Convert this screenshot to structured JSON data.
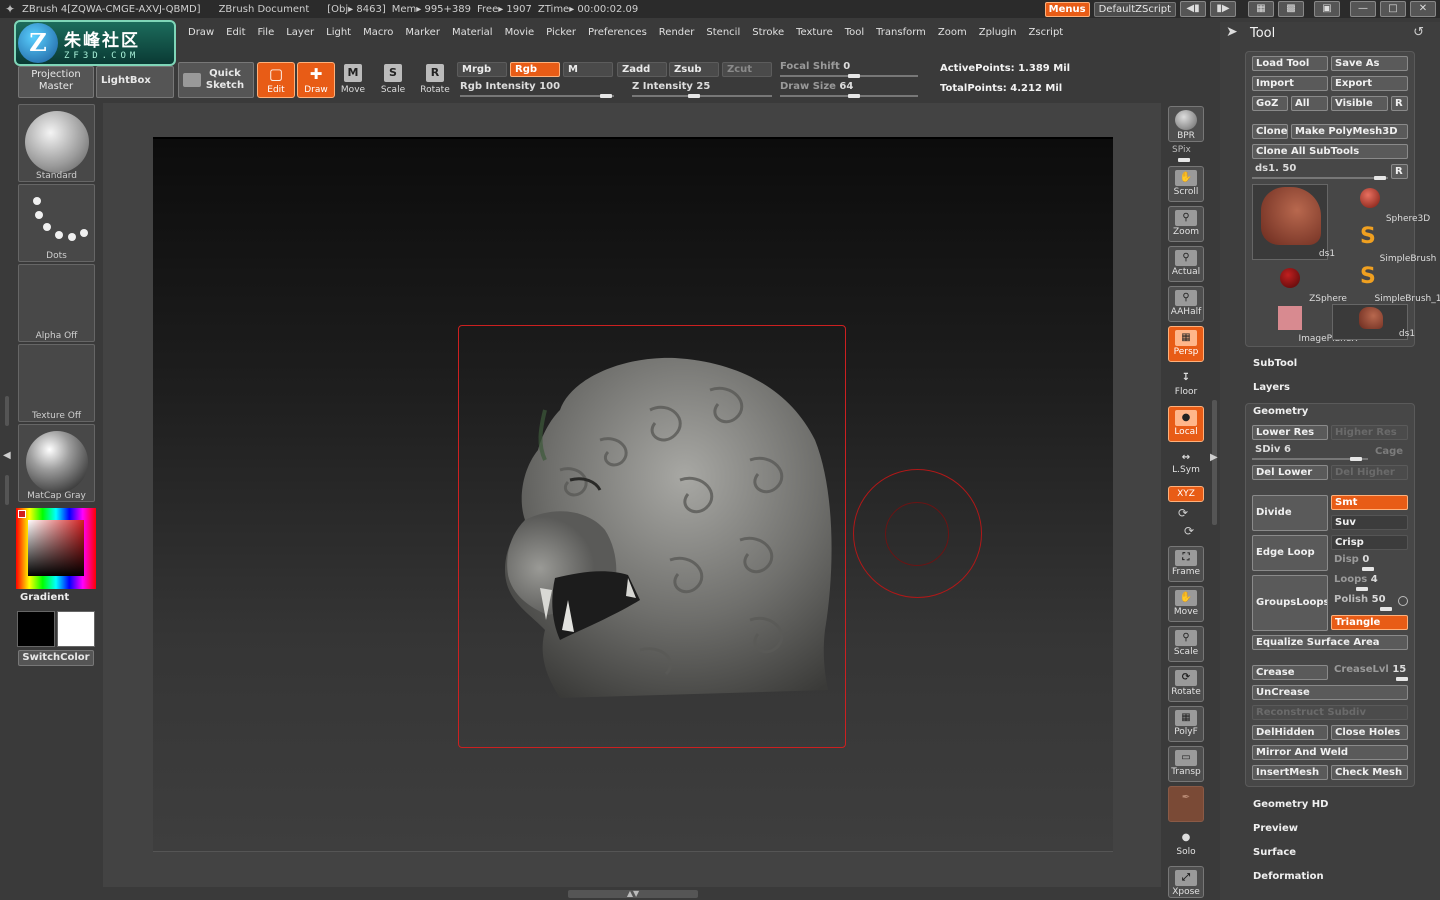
{
  "titlebar": {
    "app_title": "ZBrush 4[ZQWA-CMGE-AXVJ-QBMD]",
    "document": "ZBrush Document",
    "obj": "[Obj▸ 8463]",
    "mem": "Mem▸ 995+389",
    "free": "Free▸ 1907",
    "ztime": "ZTime▸ 00:00:02.09",
    "menus_label": "Menus",
    "script_label": "DefaultZScript"
  },
  "logo": {
    "mark": "Z",
    "cn": "朱峰社区",
    "en": "ZF3D.COM"
  },
  "menubar": [
    "Draw",
    "Edit",
    "File",
    "Layer",
    "Light",
    "Macro",
    "Marker",
    "Material",
    "Movie",
    "Picker",
    "Preferences",
    "Render",
    "Stencil",
    "Stroke",
    "Texture",
    "Tool",
    "Transform",
    "Zoom",
    "Zplugin",
    "Zscript"
  ],
  "shelf": {
    "projection_master": "Projection Master",
    "lightbox": "LightBox",
    "quick_sketch": "Quick Sketch",
    "edit": "Edit",
    "draw": "Draw",
    "move": "Move",
    "scale": "Scale",
    "rotate": "Rotate",
    "move_ico": "M",
    "scale_ico": "S",
    "rotate_ico": "R"
  },
  "params": {
    "mrgb": "Mrgb",
    "rgb": "Rgb",
    "m": "M",
    "zadd": "Zadd",
    "zsub": "Zsub",
    "zcut": "Zcut",
    "rgb_intensity_label": "Rgb Intensity",
    "rgb_intensity": "100",
    "z_intensity_label": "Z Intensity",
    "z_intensity": "25",
    "focal_shift_label": "Focal Shift",
    "focal_shift": "0",
    "draw_size_label": "Draw Size",
    "draw_size": "64",
    "active_points": "ActivePoints: 1.389 Mil",
    "total_points": "TotalPoints: 4.212 Mil"
  },
  "left": {
    "brush": "Standard",
    "stroke": "Dots",
    "alpha": "Alpha Off",
    "texture": "Texture Off",
    "material": "MatCap Gray",
    "gradient": "Gradient",
    "switch_color": "SwitchColor"
  },
  "dock": {
    "bpr": "BPR",
    "spix": "SPix",
    "scroll": "Scroll",
    "zoom": "Zoom",
    "actual": "Actual",
    "aahalf": "AAHalf",
    "persp": "Persp",
    "floor": "Floor",
    "local": "Local",
    "lsym": "L.Sym",
    "xyz": "XYZ",
    "frame": "Frame",
    "move": "Move",
    "scale": "Scale",
    "rotate": "Rotate",
    "polyf": "PolyF",
    "transp": "Transp",
    "solo": "Solo",
    "xpose": "Xpose"
  },
  "tool": {
    "title": "Tool",
    "load_tool": "Load Tool",
    "save_as": "Save As",
    "import": "Import",
    "export": "Export",
    "goz": "GoZ",
    "all": "All",
    "visible": "Visible",
    "r": "R",
    "clone": "Clone",
    "make_polymesh": "Make PolyMesh3D",
    "clone_all": "Clone All SubTools",
    "ds1_label": "ds1.",
    "ds1_value": "50",
    "thumbs": [
      "ds1",
      "Sphere3D",
      "SimpleBrush",
      "ZSphere",
      "SimpleBrush_1",
      "ImagePlaneX",
      "ds1"
    ],
    "subtool": "SubTool",
    "layers": "Layers",
    "geometry": "Geometry",
    "lower_res": "Lower Res",
    "higher_res": "Higher Res",
    "sdiv_label": "SDiv",
    "sdiv": "6",
    "cage": "Cage",
    "del_lower": "Del Lower",
    "del_higher": "Del Higher",
    "divide": "Divide",
    "smt": "Smt",
    "suv": "Suv",
    "edge_loop": "Edge Loop",
    "crisp": "Crisp",
    "disp_label": "Disp",
    "disp": "0",
    "groups_loops": "GroupsLoops",
    "loops_label": "Loops",
    "loops": "4",
    "polish_label": "Polish",
    "polish": "50",
    "triangle": "Triangle",
    "equalize": "Equalize Surface Area",
    "crease": "Crease",
    "crease_lvl_label": "CreaseLvl",
    "crease_lvl": "15",
    "uncrease": "UnCrease",
    "reconstruct": "Reconstruct Subdiv",
    "delhidden": "DelHidden",
    "close_holes": "Close Holes",
    "mirror_weld": "Mirror And Weld",
    "insertmesh": "InsertMesh",
    "check_mesh": "Check Mesh",
    "geometry_hd": "Geometry HD",
    "preview": "Preview",
    "surface": "Surface",
    "deformation": "Deformation"
  },
  "colors": {
    "accent": "#e85c16",
    "panel": "#474747",
    "brush_ring": "#b01818"
  }
}
